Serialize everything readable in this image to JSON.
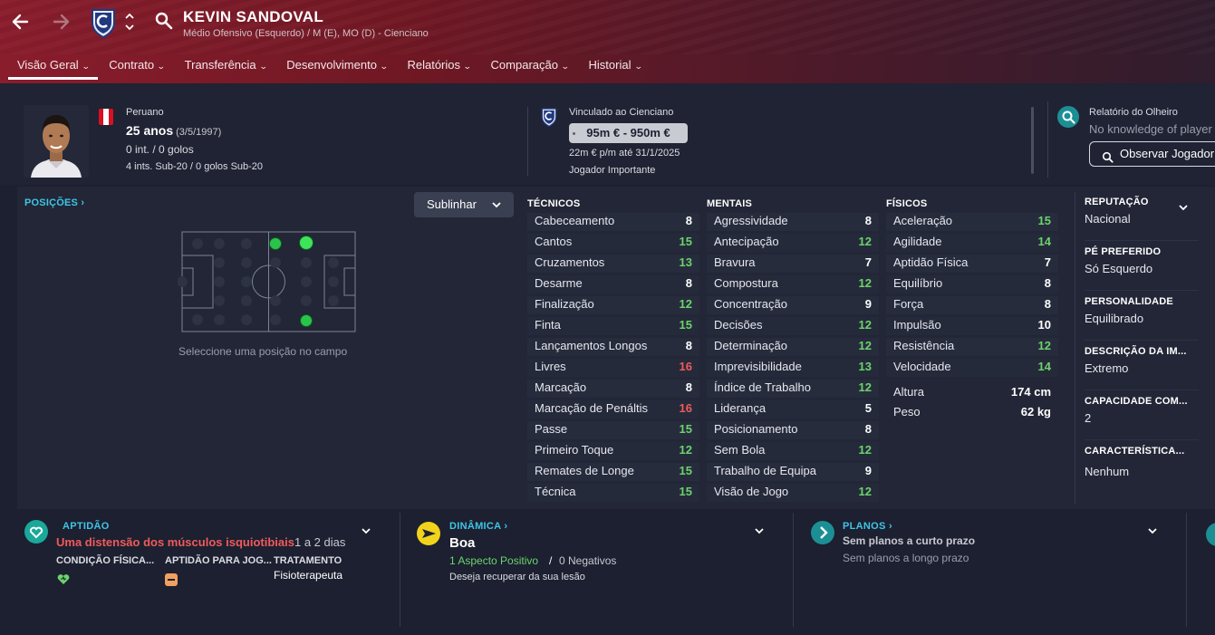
{
  "header": {
    "player_name": "KEVIN SANDOVAL",
    "subtitle": "Médio Ofensivo (Esquerdo) / M (E), MO (D) - Cienciano",
    "tabs": [
      {
        "label": "Visão Geral"
      },
      {
        "label": "Contrato"
      },
      {
        "label": "Transferência"
      },
      {
        "label": "Desenvolvimento"
      },
      {
        "label": "Relatórios"
      },
      {
        "label": "Comparação"
      },
      {
        "label": "Historial"
      }
    ],
    "active_tab": "Visão Geral"
  },
  "profile": {
    "nationality": "Peruano",
    "age": "25 anos",
    "dob": "(3/5/1997)",
    "caps": "0 int. / 0 golos",
    "u20_caps": "4 ints. Sub-20 / 0 golos Sub-20"
  },
  "contract": {
    "title": "Vinculado ao Cienciano",
    "value": "95m € - 950m €",
    "wage": "22m € p/m até 31/1/2025",
    "role": "Jogador Importante"
  },
  "scout": {
    "title": "Relatório do Olheiro",
    "text": "No knowledge of player",
    "button": "Observar Jogador"
  },
  "positions": {
    "link": "POSIÇÕES",
    "hint": "Seleccione uma posição no campo",
    "highlight_button": "Sublinhar"
  },
  "attributes": {
    "technical": {
      "title": "TÉCNICOS",
      "items": [
        {
          "name": "Cabeceamento",
          "value": "8"
        },
        {
          "name": "Cantos",
          "value": "15"
        },
        {
          "name": "Cruzamentos",
          "value": "13"
        },
        {
          "name": "Desarme",
          "value": "8"
        },
        {
          "name": "Finalização",
          "value": "12"
        },
        {
          "name": "Finta",
          "value": "15"
        },
        {
          "name": "Lançamentos Longos",
          "value": "8"
        },
        {
          "name": "Livres",
          "value": "16"
        },
        {
          "name": "Marcação",
          "value": "8"
        },
        {
          "name": "Marcação de Penáltis",
          "value": "16"
        },
        {
          "name": "Passe",
          "value": "15"
        },
        {
          "name": "Primeiro Toque",
          "value": "12"
        },
        {
          "name": "Remates de Longe",
          "value": "15"
        },
        {
          "name": "Técnica",
          "value": "15"
        }
      ]
    },
    "mental": {
      "title": "MENTAIS",
      "items": [
        {
          "name": "Agressividade",
          "value": "8"
        },
        {
          "name": "Antecipação",
          "value": "12"
        },
        {
          "name": "Bravura",
          "value": "7"
        },
        {
          "name": "Compostura",
          "value": "12"
        },
        {
          "name": "Concentração",
          "value": "9"
        },
        {
          "name": "Decisões",
          "value": "12"
        },
        {
          "name": "Determinação",
          "value": "12"
        },
        {
          "name": "Imprevisibilidade",
          "value": "13"
        },
        {
          "name": "Índice de Trabalho",
          "value": "12"
        },
        {
          "name": "Liderança",
          "value": "5"
        },
        {
          "name": "Posicionamento",
          "value": "8"
        },
        {
          "name": "Sem Bola",
          "value": "12"
        },
        {
          "name": "Trabalho de Equipa",
          "value": "9"
        },
        {
          "name": "Visão de Jogo",
          "value": "12"
        }
      ]
    },
    "physical": {
      "title": "FÍSICOS",
      "items": [
        {
          "name": "Aceleração",
          "value": "15"
        },
        {
          "name": "Agilidade",
          "value": "14"
        },
        {
          "name": "Aptidão Física",
          "value": "7"
        },
        {
          "name": "Equilíbrio",
          "value": "8"
        },
        {
          "name": "Força",
          "value": "8"
        },
        {
          "name": "Impulsão",
          "value": "10"
        },
        {
          "name": "Resistência",
          "value": "12"
        },
        {
          "name": "Velocidade",
          "value": "14"
        }
      ],
      "height_label": "Altura",
      "height": "174 cm",
      "weight_label": "Peso",
      "weight": "62 kg"
    }
  },
  "side_info": [
    {
      "key": "REPUTAÇÃO",
      "value": "Nacional"
    },
    {
      "key": "PÉ PREFERIDO",
      "value": "Só Esquerdo"
    },
    {
      "key": "PERSONALIDADE",
      "value": "Equilibrado"
    },
    {
      "key": "DESCRIÇÃO DA IM...",
      "value": "Extremo"
    },
    {
      "key": "CAPACIDADE COM...",
      "value": "2"
    },
    {
      "key": "CARACTERÍSTICA...",
      "value": "Nenhum"
    }
  ],
  "fitness": {
    "title": "APTIDÃO",
    "injury": "Uma distensão dos músculos isquiotibiais",
    "injury_duration": "1 a 2 dias",
    "condition_label": "CONDIÇÃO FÍSICA...",
    "match_fitness_label": "APTIDÃO PARA JOG...",
    "treatment_label": "TRATAMENTO",
    "treatment_value": "Fisioterapeuta"
  },
  "dynamics": {
    "title": "DINÂMICA",
    "value": "Boa",
    "positives": "1 Aspecto Positivo",
    "separator": "/",
    "negatives": "0 Negativos",
    "wish": "Deseja recuperar da sua lesão"
  },
  "plans": {
    "title": "PLANOS",
    "short": "Sem planos a curto prazo",
    "long": "Sem planos a longo prazo"
  },
  "colors": {
    "header_red": "#8a1d2c",
    "accent_cyan": "#3fc5e6",
    "value_green": "#6cd36c",
    "value_red": "#f05a5a",
    "value_white": "#ffffff",
    "injury_red": "#f05a5a"
  }
}
